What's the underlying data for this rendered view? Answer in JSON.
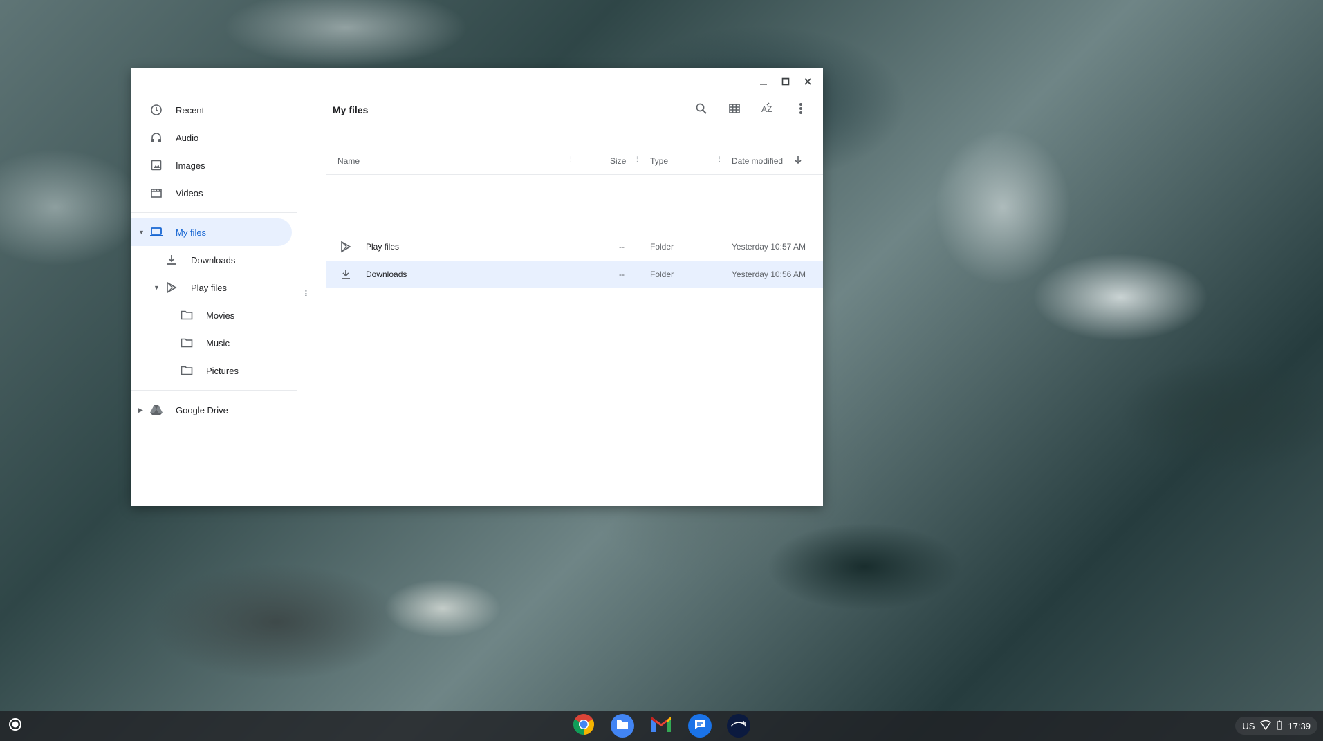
{
  "window": {
    "title": "My files",
    "controls": [
      "minimize",
      "maximize",
      "close"
    ]
  },
  "sidebar": {
    "items": [
      {
        "label": "Recent",
        "icon": "clock-icon"
      },
      {
        "label": "Audio",
        "icon": "headphones-icon"
      },
      {
        "label": "Images",
        "icon": "image-icon"
      },
      {
        "label": "Videos",
        "icon": "film-icon"
      }
    ],
    "my_files": {
      "label": "My files",
      "icon": "laptop-icon",
      "children": [
        {
          "label": "Downloads",
          "icon": "download-icon"
        },
        {
          "label": "Play files",
          "icon": "play-store-icon",
          "children": [
            {
              "label": "Movies",
              "icon": "folder-icon"
            },
            {
              "label": "Music",
              "icon": "folder-icon"
            },
            {
              "label": "Pictures",
              "icon": "folder-icon"
            }
          ]
        }
      ]
    },
    "google_drive": {
      "label": "Google Drive",
      "icon": "drive-icon"
    }
  },
  "main": {
    "title": "My files",
    "toolbar": [
      "search-icon",
      "grid-view-icon",
      "sort-az-icon",
      "more-vert-icon"
    ],
    "columns": {
      "name": "Name",
      "size": "Size",
      "type": "Type",
      "date": "Date modified"
    },
    "rows": [
      {
        "name": "Play files",
        "size": "--",
        "type": "Folder",
        "date": "Yesterday 10:57 AM",
        "icon": "play-store-icon",
        "selected": false
      },
      {
        "name": "Downloads",
        "size": "--",
        "type": "Folder",
        "date": "Yesterday 10:56 AM",
        "icon": "download-icon",
        "selected": true
      }
    ]
  },
  "shelf": {
    "apps": [
      "chrome-icon",
      "files-icon",
      "gmail-icon",
      "messages-icon",
      "disney-plus-icon"
    ],
    "status": {
      "keyboard": "US",
      "time": "17:39"
    }
  },
  "colors": {
    "accent": "#1967d2",
    "selection": "#e8f0fe"
  }
}
